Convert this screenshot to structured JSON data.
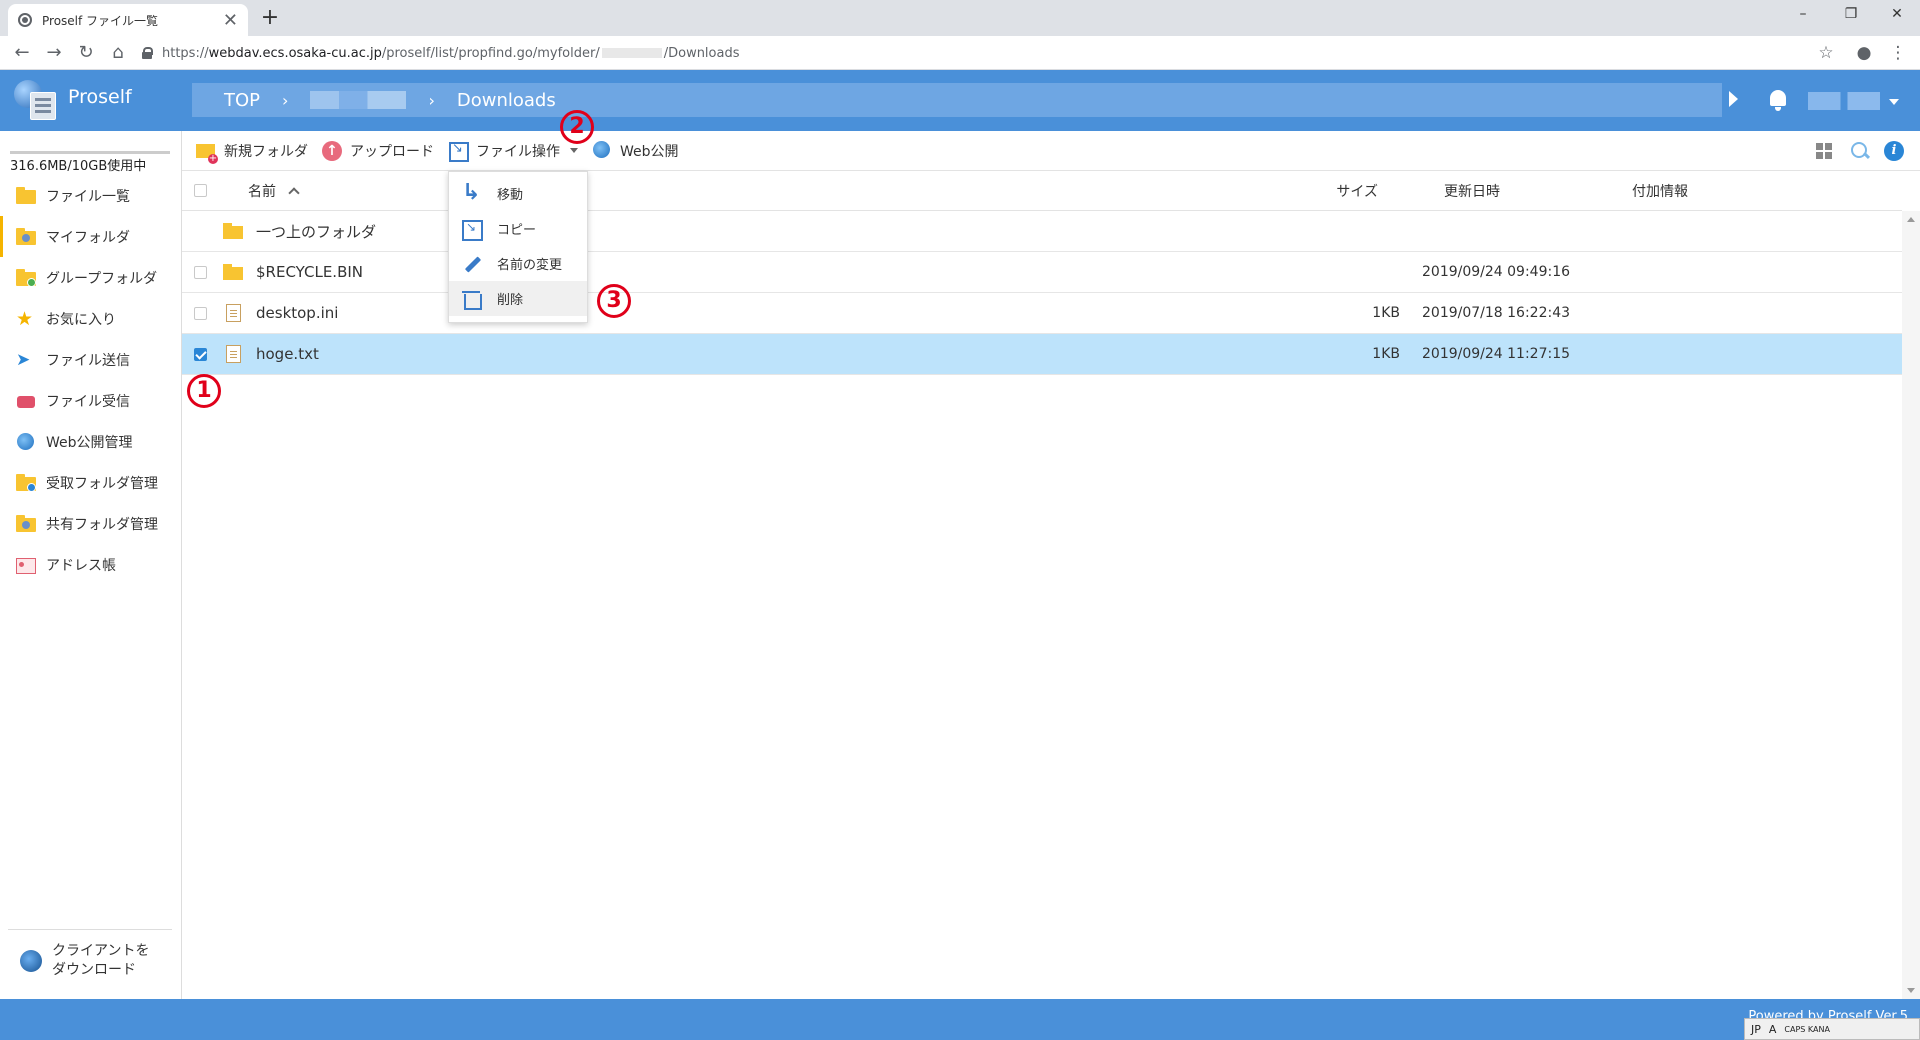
{
  "browser": {
    "tab_title": "Proself ファイル一覧",
    "tab_close": "✕",
    "new_tab": "+",
    "url_prefix": "https://",
    "url_host": "webdav.ecs.osaka-cu.ac.jp",
    "url_path": "/proself/list/propfind.go/myfolder/",
    "url_suffix": "/Downloads",
    "window_buttons": {
      "minimize": "–",
      "restore": "❐",
      "close": "✕"
    },
    "nav_icons": {
      "back": "←",
      "forward": "→",
      "reload": "↻",
      "home": "⌂"
    },
    "star": "☆",
    "account": "●",
    "menu": "⋮"
  },
  "header": {
    "app_name": "Proself",
    "breadcrumb": {
      "top": "TOP",
      "sep": "›",
      "current": "Downloads"
    }
  },
  "sidebar": {
    "quota": "316.6MB/10GB使用中",
    "items": [
      {
        "label": "ファイル一覧"
      },
      {
        "label": "マイフォルダ"
      },
      {
        "label": "グループフォルダ"
      },
      {
        "label": "お気に入り"
      },
      {
        "label": "ファイル送信"
      },
      {
        "label": "ファイル受信"
      },
      {
        "label": "Web公開管理"
      },
      {
        "label": "受取フォルダ管理"
      },
      {
        "label": "共有フォルダ管理"
      },
      {
        "label": "アドレス帳"
      }
    ],
    "client_download": "クライアントを\nダウンロード"
  },
  "toolbar": {
    "new_folder": "新規フォルダ",
    "upload": "アップロード",
    "file_ops": "ファイル操作",
    "web_publish": "Web公開"
  },
  "table": {
    "headers": {
      "name": "名前",
      "size": "サイズ",
      "modified": "更新日時",
      "extra": "付加情報"
    },
    "rows": [
      {
        "name": "一つ上のフォルダ",
        "size": "",
        "modified": "",
        "type": "parent"
      },
      {
        "name": "$RECYCLE.BIN",
        "size": "",
        "modified": "2019/09/24 09:49:16",
        "type": "folder"
      },
      {
        "name": "desktop.ini",
        "size": "1KB",
        "modified": "2019/07/18 16:22:43",
        "type": "file"
      },
      {
        "name": "hoge.txt",
        "size": "1KB",
        "modified": "2019/09/24 11:27:15",
        "type": "file",
        "selected": true
      }
    ]
  },
  "dropdown": {
    "move": "移動",
    "copy": "コピー",
    "rename": "名前の変更",
    "delete": "削除"
  },
  "annotations": {
    "one": "1",
    "two": "2",
    "three": "3"
  },
  "footer": {
    "powered": "Powered by Proself Ver.5",
    "ime": [
      "JP",
      "A",
      "CAPS KANA"
    ]
  },
  "colors": {
    "header_blue": "#4a90d9",
    "selected_row": "#bde3fb",
    "annotation_red": "#e0001a",
    "active_marker": "#f5b400"
  }
}
